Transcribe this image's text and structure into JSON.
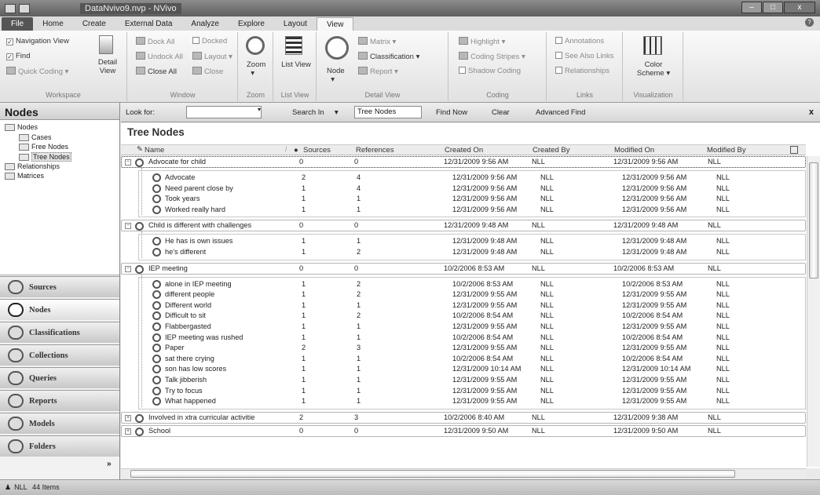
{
  "window": {
    "title": "DataNvivo9.nvp - NVivo"
  },
  "tabs": [
    "File",
    "Home",
    "Create",
    "External Data",
    "Analyze",
    "Explore",
    "Layout",
    "View"
  ],
  "ribbon": {
    "workspace": {
      "nav_view": "Navigation View",
      "find": "Find",
      "quick_coding": "Quick Coding",
      "detail_view": "Detail View",
      "caption": "Workspace"
    },
    "window": {
      "dock_all": "Dock All",
      "undock_all": "Undock All",
      "close_all": "Close All",
      "docked": "Docked",
      "layout": "Layout",
      "close": "Close",
      "caption": "Window"
    },
    "zoom": {
      "label": "Zoom",
      "caption": "Zoom"
    },
    "listview": {
      "label": "List View",
      "caption": "List View"
    },
    "detail": {
      "node": "Node",
      "matrix": "Matrix",
      "classification": "Classification",
      "report": "Report",
      "caption": "Detail View"
    },
    "coding": {
      "highlight": "Highlight",
      "coding_stripes": "Coding Stripes",
      "shadow_coding": "Shadow Coding",
      "caption": "Coding"
    },
    "links": {
      "annotations": "Annotations",
      "see_also": "See Also Links",
      "relationships": "Relationships",
      "caption": "Links"
    },
    "visualization": {
      "color_scheme": "Color Scheme",
      "caption": "Visualization"
    }
  },
  "nav": {
    "header": "Nodes",
    "tree": [
      {
        "label": "Nodes",
        "indent": 0
      },
      {
        "label": "Cases",
        "indent": 1
      },
      {
        "label": "Free Nodes",
        "indent": 1
      },
      {
        "label": "Tree Nodes",
        "indent": 1,
        "selected": true
      },
      {
        "label": "Relationships",
        "indent": 0
      },
      {
        "label": "Matrices",
        "indent": 0
      }
    ],
    "buttons": [
      "Sources",
      "Nodes",
      "Classifications",
      "Collections",
      "Queries",
      "Reports",
      "Models",
      "Folders"
    ]
  },
  "findbar": {
    "look_for": "Look for:",
    "look_value": "",
    "search_in": "Search In",
    "search_value": "Tree Nodes",
    "find_now": "Find Now",
    "clear": "Clear",
    "advanced_find": "Advanced Find",
    "close": "x"
  },
  "main": {
    "title": "Tree Nodes",
    "columns": {
      "name": "Name",
      "sources": "Sources",
      "references": "References",
      "created_on": "Created On",
      "created_by": "Created By",
      "modified_on": "Modified On",
      "modified_by": "Modified By"
    },
    "groups": [
      {
        "name": "Advocate for child",
        "sources": "0",
        "references": "0",
        "created_on": "12/31/2009 9:56 AM",
        "created_by": "NLL",
        "modified_on": "12/31/2009 9:56 AM",
        "modified_by": "NLL",
        "children": [
          [
            "Advocate",
            "2",
            "4",
            "12/31/2009 9:56 AM",
            "NLL",
            "12/31/2009 9:56 AM",
            "NLL"
          ],
          [
            "Need parent close by",
            "1",
            "4",
            "12/31/2009 9:56 AM",
            "NLL",
            "12/31/2009 9:56 AM",
            "NLL"
          ],
          [
            "Took years",
            "1",
            "1",
            "12/31/2009 9:56 AM",
            "NLL",
            "12/31/2009 9:56 AM",
            "NLL"
          ],
          [
            "Worked really hard",
            "1",
            "1",
            "12/31/2009 9:56 AM",
            "NLL",
            "12/31/2009 9:56 AM",
            "NLL"
          ]
        ]
      },
      {
        "name": "Child is different with challenges",
        "sources": "0",
        "references": "0",
        "created_on": "12/31/2009 9:48 AM",
        "created_by": "NLL",
        "modified_on": "12/31/2009 9:48 AM",
        "modified_by": "NLL",
        "children": [
          [
            "He has is own issues",
            "1",
            "1",
            "12/31/2009 9:48 AM",
            "NLL",
            "12/31/2009 9:48 AM",
            "NLL"
          ],
          [
            "he's different",
            "1",
            "2",
            "12/31/2009 9:48 AM",
            "NLL",
            "12/31/2009 9:48 AM",
            "NLL"
          ]
        ]
      },
      {
        "name": "IEP meeting",
        "sources": "0",
        "references": "0",
        "created_on": "10/2/2006 8:53 AM",
        "created_by": "NLL",
        "modified_on": "10/2/2006 8:53 AM",
        "modified_by": "NLL",
        "children": [
          [
            "alone in IEP meeting",
            "1",
            "2",
            "10/2/2006 8:53 AM",
            "NLL",
            "10/2/2006 8:53 AM",
            "NLL"
          ],
          [
            "different people",
            "1",
            "2",
            "12/31/2009 9:55 AM",
            "NLL",
            "12/31/2009 9:55 AM",
            "NLL"
          ],
          [
            "Different world",
            "1",
            "1",
            "12/31/2009 9:55 AM",
            "NLL",
            "12/31/2009 9:55 AM",
            "NLL"
          ],
          [
            "Difficult to sit",
            "1",
            "2",
            "10/2/2006 8:54 AM",
            "NLL",
            "10/2/2006 8:54 AM",
            "NLL"
          ],
          [
            "Flabbergasted",
            "1",
            "1",
            "12/31/2009 9:55 AM",
            "NLL",
            "12/31/2009 9:55 AM",
            "NLL"
          ],
          [
            "IEP meeting was rushed",
            "1",
            "1",
            "10/2/2006 8:54 AM",
            "NLL",
            "10/2/2006 8:54 AM",
            "NLL"
          ],
          [
            "Paper",
            "2",
            "3",
            "12/31/2009 9:55 AM",
            "NLL",
            "12/31/2009 9:55 AM",
            "NLL"
          ],
          [
            "sat there crying",
            "1",
            "1",
            "10/2/2006 8:54 AM",
            "NLL",
            "10/2/2006 8:54 AM",
            "NLL"
          ],
          [
            "son has low scores",
            "1",
            "1",
            "12/31/2009 10:14 AM",
            "NLL",
            "12/31/2009 10:14 AM",
            "NLL"
          ],
          [
            "Talk jibberish",
            "1",
            "1",
            "12/31/2009 9:55 AM",
            "NLL",
            "12/31/2009 9:55 AM",
            "NLL"
          ],
          [
            "Try to focus",
            "1",
            "1",
            "12/31/2009 9:55 AM",
            "NLL",
            "12/31/2009 9:55 AM",
            "NLL"
          ],
          [
            "What happened",
            "1",
            "1",
            "12/31/2009 9:55 AM",
            "NLL",
            "12/31/2009 9:55 AM",
            "NLL"
          ]
        ]
      },
      {
        "name": "Involved in xtra curricular activitie",
        "sources": "2",
        "references": "3",
        "created_on": "10/2/2006 8:40 AM",
        "created_by": "NLL",
        "modified_on": "12/31/2009 9:38 AM",
        "modified_by": "NLL",
        "children": []
      },
      {
        "name": "School",
        "sources": "0",
        "references": "0",
        "created_on": "12/31/2009 9:50 AM",
        "created_by": "NLL",
        "modified_on": "12/31/2009 9:50 AM",
        "modified_by": "NLL",
        "children": []
      }
    ]
  },
  "status": {
    "user": "NLL",
    "items": "44 Items"
  }
}
